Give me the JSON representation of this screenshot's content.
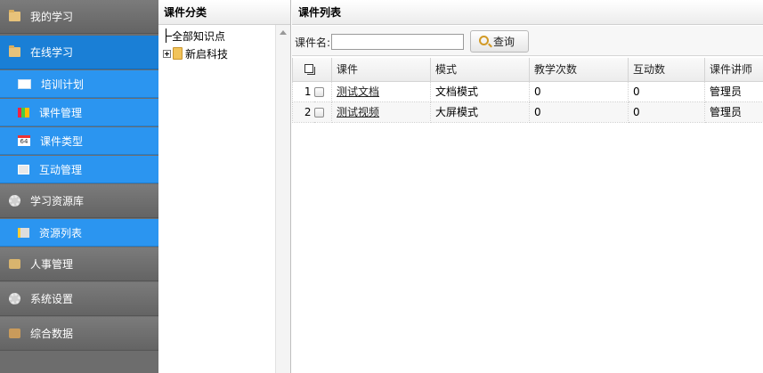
{
  "nav": {
    "items": [
      {
        "label": "我的学习",
        "icon": "folder-icon",
        "active": false
      },
      {
        "label": "在线学习",
        "icon": "folder-icon",
        "active": true
      },
      {
        "label": "学习资源库",
        "icon": "gear-icon",
        "active": false
      },
      {
        "label": "人事管理",
        "icon": "person-icon",
        "active": false
      },
      {
        "label": "系统设置",
        "icon": "gear-icon",
        "active": false
      },
      {
        "label": "综合数据",
        "icon": "box-icon",
        "active": false
      }
    ],
    "online_sub": [
      {
        "label": "培训计划",
        "icon": "plan-icon"
      },
      {
        "label": "课件管理",
        "icon": "chart-icon"
      },
      {
        "label": "课件类型",
        "icon": "calendar-icon"
      },
      {
        "label": "互动管理",
        "icon": "screen-icon"
      }
    ],
    "resource_sub": [
      {
        "label": "资源列表",
        "icon": "list-icon"
      }
    ],
    "calendar_icon_text": "64"
  },
  "tree": {
    "title": "课件分类",
    "nodes": [
      {
        "label": "全部知识点"
      },
      {
        "label": "新启科技"
      }
    ]
  },
  "list": {
    "title": "课件列表",
    "search": {
      "label": "课件名:",
      "value": "",
      "placeholder": ""
    },
    "query_button": "查询",
    "columns": [
      "课件",
      "模式",
      "教学次数",
      "互动数",
      "课件讲师"
    ],
    "rows": [
      {
        "num": "1",
        "name": "测试文档",
        "mode": "文档模式",
        "teach": "0",
        "interact": "0",
        "lecturer": "管理员"
      },
      {
        "num": "2",
        "name": "测试视频",
        "mode": "大屏模式",
        "teach": "0",
        "interact": "0",
        "lecturer": "管理员"
      }
    ]
  },
  "colors": {
    "nav_gray": "#6d6d6d",
    "nav_active": "#1a7fd6",
    "nav_sub": "#2b95f0"
  }
}
